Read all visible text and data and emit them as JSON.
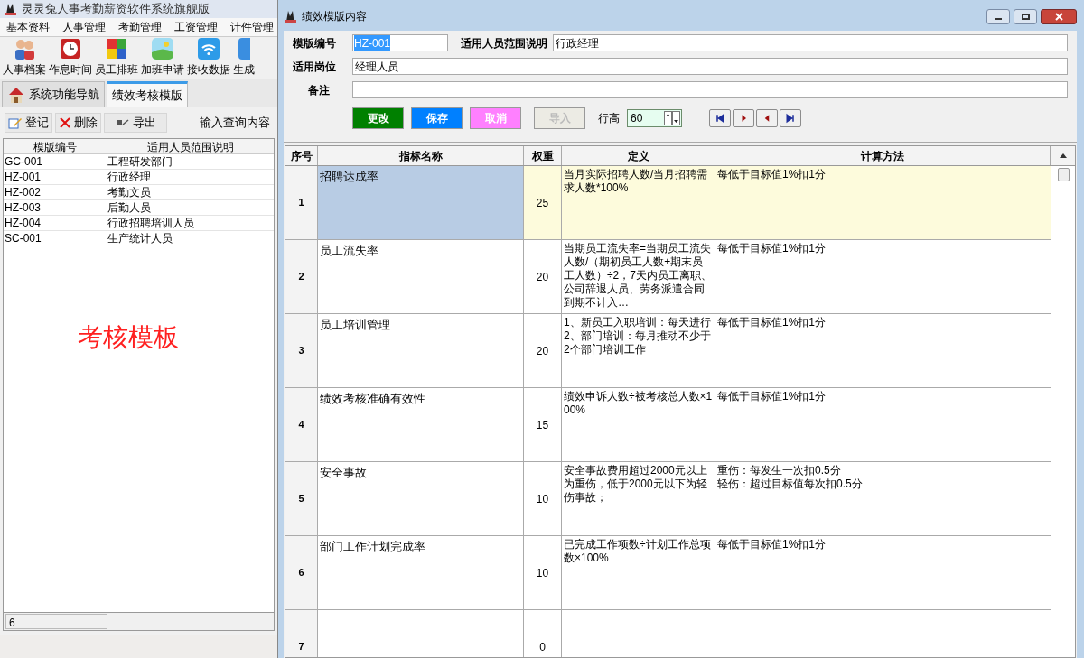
{
  "app": {
    "title": "灵灵兔人事考勤薪资软件系统旗舰版",
    "menu": [
      "基本资料",
      "人事管理",
      "考勤管理",
      "工资管理",
      "计件管理"
    ],
    "toolbar": [
      "人事档案",
      "作息时间",
      "员工排班",
      "加班申请",
      "接收数据",
      "生成"
    ],
    "tabs": [
      {
        "label": "系统功能导航",
        "selected": false
      },
      {
        "label": "绩效考核模版",
        "selected": true
      }
    ],
    "actions": [
      "登记",
      "删除",
      "导出"
    ],
    "search_label": "输入查询内容",
    "list": {
      "columns": [
        "模版编号",
        "适用人员范围说明"
      ],
      "rows": [
        {
          "code": "GC-001",
          "scope": "工程研发部门",
          "selected": false
        },
        {
          "code": "HZ-001",
          "scope": "行政经理",
          "selected": false
        },
        {
          "code": "HZ-002",
          "scope": "考勤文员",
          "selected": false
        },
        {
          "code": "HZ-003",
          "scope": "后勤人员",
          "selected": false
        },
        {
          "code": "HZ-004",
          "scope": "行政招聘培训人员",
          "selected": false
        },
        {
          "code": "SC-001",
          "scope": "生产统计人员",
          "selected": false
        }
      ]
    },
    "annotation": "考核模板",
    "status": "6"
  },
  "dialog": {
    "title": "绩效模版内容",
    "template_no": {
      "label": "模版编号",
      "value": "HZ-001"
    },
    "scope": {
      "label": "适用人员范围说明",
      "value": "行政经理"
    },
    "post": {
      "label": "适用岗位",
      "value": "经理人员"
    },
    "remark": {
      "label": "备注"
    },
    "buttons": [
      {
        "label": "更改",
        "color": "#008000",
        "disabled": false
      },
      {
        "label": "保存",
        "color": "#0080ff",
        "disabled": false
      },
      {
        "label": "取消",
        "color": "#ff80ff",
        "disabled": false
      },
      {
        "label": "导入",
        "color": "#ecebe4",
        "disabled": true
      }
    ],
    "row_height": {
      "label": "行高",
      "value": "60"
    },
    "grid": {
      "columns": [
        "序号",
        "指标名称",
        "权重",
        "定义",
        "计算方法"
      ],
      "rows": [
        {
          "no": "1",
          "name": "招聘达成率",
          "weight": "25",
          "definition": "当月实际招聘人数/当月招聘需求人数*100%",
          "method": "每低于目标值1%扣1分",
          "selected": true
        },
        {
          "no": "2",
          "name": "员工流失率",
          "weight": "20",
          "definition": "当期员工流失率=当期员工流失人数/（期初员工人数+期末员工人数）÷2，7天内员工离职、公司辞退人员、劳务派遣合同到期不计入…",
          "method": "每低于目标值1%扣1分",
          "selected": false
        },
        {
          "no": "3",
          "name": "员工培训管理",
          "weight": "20",
          "definition": [
            "1、新员工入职培训：每天进行",
            "2、部门培训：每月推动不少于2个部门培训工作"
          ],
          "method": "每低于目标值1%扣1分",
          "selected": false
        },
        {
          "no": "4",
          "name": "绩效考核准确有效性",
          "weight": "15",
          "definition": "绩效申诉人数÷被考核总人数×100%",
          "method": "每低于目标值1%扣1分",
          "selected": false
        },
        {
          "no": "5",
          "name": "安全事故",
          "weight": "10",
          "definition": "安全事故费用超过2000元以上为重伤，低于2000元以下为轻伤事故；",
          "method": [
            "重伤：每发生一次扣0.5分",
            "轻伤：超过目标值每次扣0.5分"
          ],
          "selected": false
        },
        {
          "no": "6",
          "name": "部门工作计划完成率",
          "weight": "10",
          "definition": "已完成工作项数÷计划工作总项数×100%",
          "method": "每低于目标值1%扣1分",
          "selected": false
        },
        {
          "no": "7",
          "weight": "0",
          "selected": false
        }
      ]
    }
  }
}
